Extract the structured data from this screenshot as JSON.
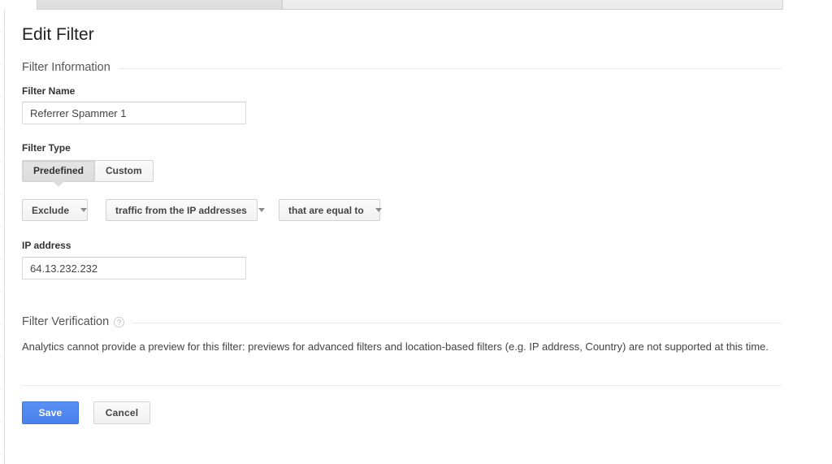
{
  "window": {
    "tabs": [
      {
        "label": "",
        "state": "active"
      },
      {
        "label": "",
        "state": "inactive"
      }
    ]
  },
  "page": {
    "title": "Edit Filter"
  },
  "filter_information": {
    "section_label": "Filter Information",
    "filter_name": {
      "label": "Filter Name",
      "value": "Referrer Spammer 1",
      "placeholder": ""
    },
    "filter_type": {
      "label": "Filter Type",
      "options": [
        {
          "label": "Predefined",
          "selected": true
        },
        {
          "label": "Custom",
          "selected": false
        }
      ],
      "dropdowns": [
        {
          "name": "filter-verb",
          "value": "Exclude"
        },
        {
          "name": "filter-subject",
          "value": "traffic from the IP addresses"
        },
        {
          "name": "filter-expression",
          "value": "that are equal to"
        }
      ]
    },
    "ip_address": {
      "label": "IP address",
      "value": "64.13.232.232",
      "placeholder": ""
    }
  },
  "filter_verification": {
    "section_label": "Filter Verification",
    "help_icon": "help-question-icon",
    "help_glyph": "?",
    "message": "Analytics cannot provide a preview for this filter: previews for advanced filters and location-based filters (e.g. IP address, Country) are not supported at this time."
  },
  "actions": {
    "save_label": "Save",
    "cancel_label": "Cancel"
  },
  "colors": {
    "accent_blue": "#4d87f0",
    "text_primary": "#333333",
    "text_secondary": "#555555",
    "border": "#d9d9d9",
    "rule": "#e8e8e8",
    "tab_active_bg": "#e3e3e3",
    "tab_inactive_bg": "#efefef"
  }
}
